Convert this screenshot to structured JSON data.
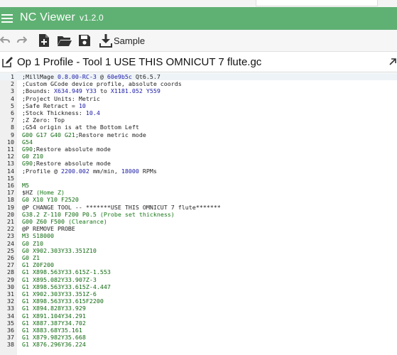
{
  "app": {
    "title": "NC Viewer",
    "version": "v1.2.0"
  },
  "toolbar": {
    "sample_label": "Sample"
  },
  "file": {
    "title": "Op 1 Profile - Tool 1 USE THIS OMNICUT 7 flute.gc"
  },
  "colors": {
    "appbar": "#5fb173",
    "accent_blue": "#1a1aa6",
    "accent_green": "#116a11"
  },
  "editor": {
    "lines": [
      {
        "n": "1",
        "t": [
          [
            ";MillMage ",
            "default"
          ],
          [
            "0.8.00-RC-3",
            "num"
          ],
          [
            " @ ",
            "default"
          ],
          [
            "60e9b5c",
            "num"
          ],
          [
            " Qt6.5.7",
            "default"
          ]
        ],
        "active": true
      },
      {
        "n": "2",
        "t": [
          [
            ";Custom GCode device profile, absolute coords",
            "default"
          ]
        ]
      },
      {
        "n": "3",
        "t": [
          [
            ";Bounds: ",
            "default"
          ],
          [
            "X634.949 Y33",
            "num"
          ],
          [
            " to ",
            "default"
          ],
          [
            "X1181.052 Y559",
            "num"
          ]
        ]
      },
      {
        "n": "4",
        "t": [
          [
            ";Project Units: Metric",
            "default"
          ]
        ]
      },
      {
        "n": "5",
        "t": [
          [
            ";Safe Retract = ",
            "default"
          ],
          [
            "10",
            "num"
          ]
        ]
      },
      {
        "n": "6",
        "t": [
          [
            ";Stock Thickness: ",
            "default"
          ],
          [
            "10.4",
            "num"
          ]
        ]
      },
      {
        "n": "7",
        "t": [
          [
            ";Z Zero: Top",
            "default"
          ]
        ]
      },
      {
        "n": "8",
        "t": [
          [
            ";G54 origin is at the Bottom Left",
            "default"
          ]
        ]
      },
      {
        "n": "9",
        "t": [
          [
            "G00 G17 G40 G21",
            "cmd"
          ],
          [
            ";Restore metric mode",
            "default"
          ]
        ]
      },
      {
        "n": "10",
        "t": [
          [
            "G54",
            "cmd"
          ]
        ]
      },
      {
        "n": "11",
        "t": [
          [
            "G90",
            "cmd"
          ],
          [
            ";Restore absolute mode",
            "default"
          ]
        ]
      },
      {
        "n": "12",
        "t": [
          [
            "G0 Z10",
            "cmd"
          ]
        ]
      },
      {
        "n": "13",
        "t": [
          [
            "G90",
            "cmd"
          ],
          [
            ";Restore absolute mode",
            "default"
          ]
        ]
      },
      {
        "n": "14",
        "t": [
          [
            ";Profile @ ",
            "default"
          ],
          [
            "2200.002",
            "num"
          ],
          [
            " mm/min, ",
            "default"
          ],
          [
            "18000",
            "num"
          ],
          [
            " RPMs",
            "default"
          ]
        ]
      },
      {
        "n": "15",
        "t": []
      },
      {
        "n": "16",
        "t": [
          [
            "M5",
            "cmd"
          ]
        ]
      },
      {
        "n": "17",
        "t": [
          [
            "$HZ",
            "default"
          ],
          [
            " (Home Z)",
            "comment"
          ]
        ]
      },
      {
        "n": "18",
        "t": [
          [
            "G0 X10 Y10 F2520",
            "cmd"
          ]
        ]
      },
      {
        "n": "19",
        "t": [
          [
            "@P CHANGE TOOL -- *******USE THIS OMNICUT 7 flute*******",
            "default"
          ]
        ]
      },
      {
        "n": "20",
        "t": [
          [
            "G38.2 Z-110 F200 P0.5",
            "cmd"
          ],
          [
            " (Probe set thickness)",
            "comment"
          ]
        ]
      },
      {
        "n": "21",
        "t": [
          [
            "G00 Z60 F500",
            "cmd"
          ],
          [
            " (Clearance)",
            "comment"
          ]
        ]
      },
      {
        "n": "22",
        "t": [
          [
            "@P REMOVE PROBE",
            "default"
          ]
        ]
      },
      {
        "n": "23",
        "t": [
          [
            "M3 S18000",
            "cmd"
          ]
        ]
      },
      {
        "n": "24",
        "t": [
          [
            "G0 Z10",
            "cmd"
          ]
        ]
      },
      {
        "n": "25",
        "t": [
          [
            "G0 X902.303Y33.351Z10",
            "cmd"
          ]
        ]
      },
      {
        "n": "26",
        "t": [
          [
            "G0 Z1",
            "cmd"
          ]
        ]
      },
      {
        "n": "27",
        "t": [
          [
            "G1 Z0F200",
            "cmd"
          ]
        ]
      },
      {
        "n": "28",
        "t": [
          [
            "G1 X898.563Y33.615Z-1.553",
            "cmd"
          ]
        ]
      },
      {
        "n": "29",
        "t": [
          [
            "G1 X895.082Y33.907Z-3",
            "cmd"
          ]
        ]
      },
      {
        "n": "30",
        "t": [
          [
            "G1 X898.563Y33.615Z-4.447",
            "cmd"
          ]
        ]
      },
      {
        "n": "31",
        "t": [
          [
            "G1 X902.303Y33.351Z-6",
            "cmd"
          ]
        ]
      },
      {
        "n": "32",
        "t": [
          [
            "G1 X898.563Y33.615F2200",
            "cmd"
          ]
        ]
      },
      {
        "n": "33",
        "t": [
          [
            "G1 X894.828Y33.929",
            "cmd"
          ]
        ]
      },
      {
        "n": "34",
        "t": [
          [
            "G1 X891.104Y34.291",
            "cmd"
          ]
        ]
      },
      {
        "n": "35",
        "t": [
          [
            "G1 X887.387Y34.702",
            "cmd"
          ]
        ]
      },
      {
        "n": "36",
        "t": [
          [
            "G1 X883.68Y35.161",
            "cmd"
          ]
        ]
      },
      {
        "n": "37",
        "t": [
          [
            "G1 X879.982Y35.668",
            "cmd"
          ]
        ]
      },
      {
        "n": "38",
        "t": [
          [
            "G1 X876.296Y36.224",
            "cmd"
          ]
        ]
      }
    ]
  }
}
